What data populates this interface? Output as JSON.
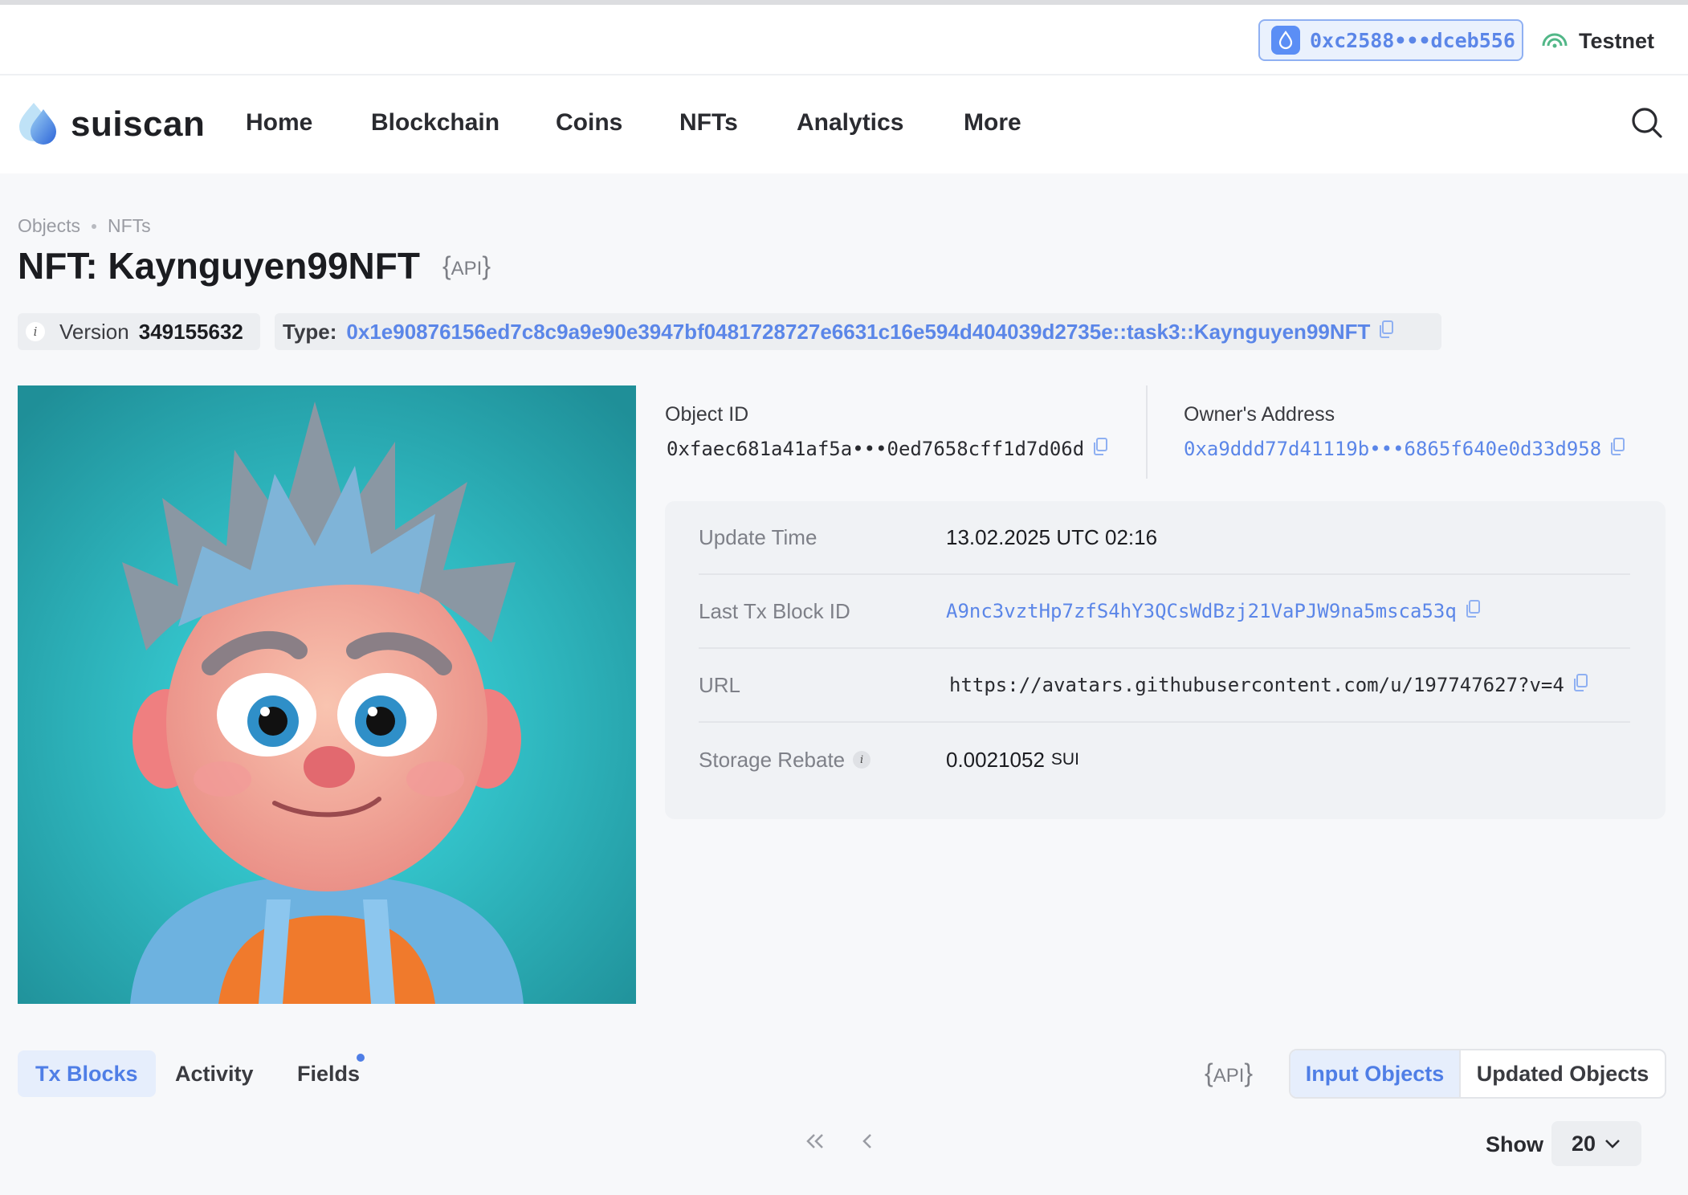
{
  "wallet": {
    "address": "0xc2588•••dceb556"
  },
  "network": {
    "label": "Testnet"
  },
  "brand": {
    "name": "suiscan"
  },
  "nav": {
    "items": [
      {
        "label": "Home"
      },
      {
        "label": "Blockchain"
      },
      {
        "label": "Coins"
      },
      {
        "label": "NFTs"
      },
      {
        "label": "Analytics"
      },
      {
        "label": "More"
      }
    ]
  },
  "breadcrumb": {
    "items": [
      "Objects",
      "NFTs"
    ]
  },
  "page": {
    "title": "NFT: Kaynguyen99NFT",
    "api_label": "API"
  },
  "version": {
    "label": "Version",
    "value": "349155632"
  },
  "type": {
    "label": "Type:",
    "value": "0x1e90876156ed7c8c9a9e90e3947bf0481728727e6631c16e594d404039d2735e::task3::Kaynguyen99NFT"
  },
  "object": {
    "id_label": "Object ID",
    "id_value": "0xfaec681a41af5a•••0ed7658cff1d7d06d",
    "owner_label": "Owner's Address",
    "owner_value": "0xa9ddd77d41119b•••6865f640e0d33d958"
  },
  "details": {
    "update_time_label": "Update Time",
    "update_time_value": "13.02.2025 UTC 02:16",
    "last_tx_label": "Last Tx Block ID",
    "last_tx_value": "A9nc3vztHp7zfS4hY3QCsWdBzj21VaPJW9na5msca53q",
    "url_label": "URL",
    "url_value": "https://avatars.githubusercontent.com/u/197747627?v=4",
    "storage_label": "Storage Rebate",
    "storage_value": "0.0021052",
    "storage_unit": "SUI"
  },
  "tabs": {
    "tx_blocks": "Tx Blocks",
    "activity": "Activity",
    "fields": "Fields",
    "api_label": "API",
    "input_objects": "Input Objects",
    "updated_objects": "Updated Objects"
  },
  "pagination": {
    "first": "«",
    "prev": "‹",
    "show_label": "Show",
    "show_value": "20"
  },
  "colors": {
    "accent": "#5b86e8",
    "teal_bg": "#2fc3c9",
    "hair": "#7fb4d8"
  }
}
